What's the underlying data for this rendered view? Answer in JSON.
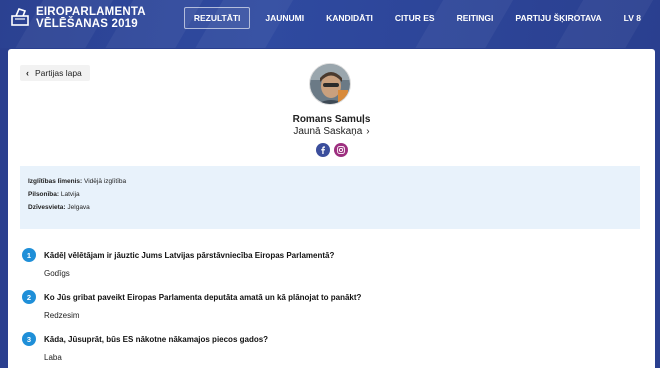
{
  "header": {
    "brand_line1": "EIROPARLAMENTA",
    "brand_line2": "VĒLĒŠANAS 2019",
    "nav": [
      {
        "label": "REZULTĀTI",
        "active": true
      },
      {
        "label": "JAUNUMI",
        "active": false
      },
      {
        "label": "KANDIDĀTI",
        "active": false
      },
      {
        "label": "CITUR ES",
        "active": false
      },
      {
        "label": "REITINGI",
        "active": false
      },
      {
        "label": "PARTIJU ŠĶIROTAVA",
        "active": false
      },
      {
        "label": "LV 8",
        "active": false
      }
    ]
  },
  "back": {
    "label": "Partijas lapa",
    "icon": "chevron-left-icon"
  },
  "candidate": {
    "name": "Romans Samuļs",
    "party": "Jaunā Saskaņa",
    "socials": [
      "facebook-icon",
      "instagram-icon"
    ]
  },
  "info": {
    "education_label": "Izglītības līmenis:",
    "education_value": "Vidējā izglītība",
    "citizenship_label": "Pilsonība:",
    "citizenship_value": "Latvija",
    "residence_label": "Dzīvesvieta:",
    "residence_value": "Jelgava"
  },
  "questions": [
    {
      "num": "1",
      "q": "Kādēļ vēlētājam ir jāuztic Jums Latvijas pārstāvniecība Eiropas Parlamentā?",
      "a": "Godīgs"
    },
    {
      "num": "2",
      "q": "Ko Jūs gribat paveikt Eiropas Parlamenta deputāta amatā un kā plānojat to panākt?",
      "a": "Redzesim"
    },
    {
      "num": "3",
      "q": "Kāda, Jūsuprāt, būs ES nākotne nākamajos piecos gados?",
      "a": "Laba"
    }
  ],
  "colors": {
    "header_bg": "#2a3f8f",
    "accent": "#1f8fd8",
    "info_bg": "#e8f2fb"
  }
}
